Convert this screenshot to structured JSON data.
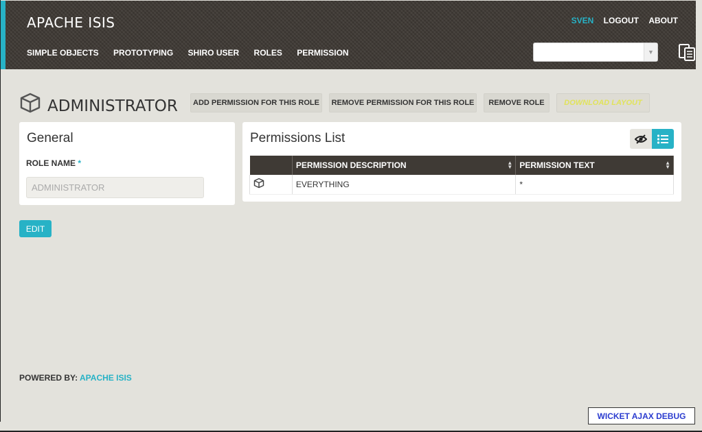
{
  "header": {
    "app_title": "APACHE ISIS",
    "user": "SVEN",
    "logout": "LOGOUT",
    "about": "ABOUT",
    "menu": [
      "SIMPLE OBJECTS",
      "PROTOTYPING",
      "SHIRO USER",
      "ROLES",
      "PERMISSION"
    ],
    "accent_color": "#27b2c6",
    "icons": [
      "chevron-down-icon",
      "clipboard-icon"
    ]
  },
  "entity": {
    "icon": "cube-icon",
    "title": "ADMINISTRATOR",
    "actions": [
      {
        "label": "ADD PERMISSION FOR THIS ROLE",
        "enabled": true
      },
      {
        "label": "REMOVE PERMISSION FOR THIS ROLE",
        "enabled": true
      },
      {
        "label": "REMOVE ROLE",
        "enabled": true
      },
      {
        "label": "DOWNLOAD LAYOUT",
        "enabled": false
      }
    ]
  },
  "general": {
    "title": "General",
    "role_name_label": "ROLE NAME",
    "required_marker": "*",
    "role_name_value": "ADMINISTRATOR",
    "edit_label": "EDIT"
  },
  "permissions": {
    "title": "Permissions List",
    "toggle_icons": [
      "eye-slash-icon",
      "list-icon"
    ],
    "columns": [
      "",
      "PERMISSION DESCRIPTION",
      "PERMISSION TEXT"
    ],
    "rows": [
      {
        "icon": "cube-icon",
        "description": "EVERYTHING",
        "text": "*"
      }
    ]
  },
  "footer": {
    "powered_by": "POWERED BY: ",
    "link": "APACHE ISIS"
  },
  "debug": {
    "label": "WICKET AJAX DEBUG"
  }
}
